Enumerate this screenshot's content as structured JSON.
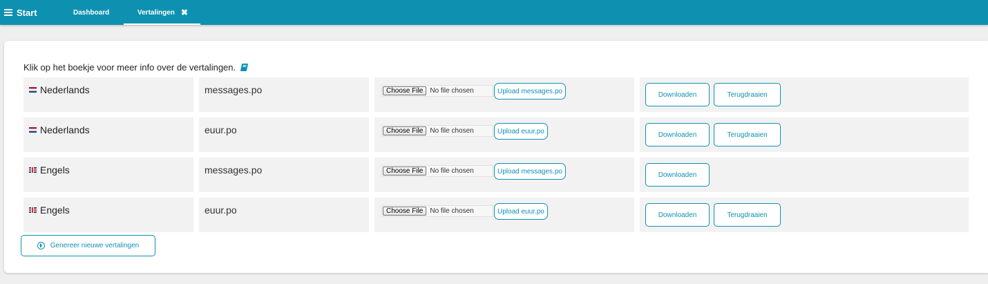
{
  "topbar": {
    "start_label": "Start",
    "tabs": [
      {
        "label": "Dashboard"
      },
      {
        "label": "Vertalingen",
        "close_icon": "✖"
      }
    ]
  },
  "intro": {
    "text": "Klik op het boekje voor meer info over de vertalingen.",
    "icon": "book-icon"
  },
  "rows": [
    {
      "flag": "nl",
      "language": "Nederlands",
      "file": "messages.po",
      "choose_label": "Choose File",
      "no_file": "No file chosen",
      "upload_label": "Upload messages.po",
      "download_label": "Downloaden",
      "revert_label": "Terugdraaien"
    },
    {
      "flag": "nl",
      "language": "Nederlands",
      "file": "euur.po",
      "choose_label": "Choose File",
      "no_file": "No file chosen",
      "upload_label": "Upload euur.po",
      "download_label": "Downloaden",
      "revert_label": "Terugdraaien"
    },
    {
      "flag": "gb",
      "language": "Engels",
      "file": "messages.po",
      "choose_label": "Choose File",
      "no_file": "No file chosen",
      "upload_label": "Upload messages.po",
      "download_label": "Downloaden"
    },
    {
      "flag": "gb",
      "language": "Engels",
      "file": "euur.po",
      "choose_label": "Choose File",
      "no_file": "No file chosen",
      "upload_label": "Upload euur.po",
      "download_label": "Downloaden",
      "revert_label": "Terugdraaien"
    }
  ],
  "generate": {
    "label": "Genereer nieuwe vertalingen",
    "icon": "arrow-up-circle-icon"
  },
  "colors": {
    "accent": "#0e91b1",
    "background": "#efefef",
    "cell": "#f2f2f2"
  }
}
